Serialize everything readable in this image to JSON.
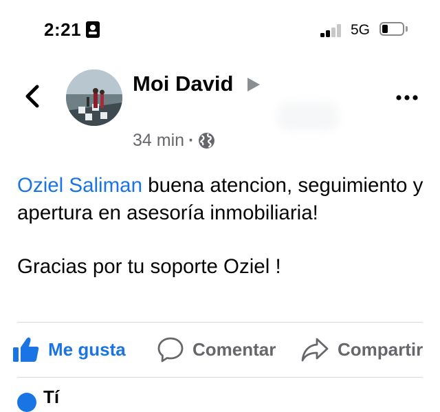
{
  "status_bar": {
    "time": "2:21",
    "network": "5G",
    "icons": [
      "contact-card-icon",
      "signal-icon",
      "battery-icon"
    ]
  },
  "post": {
    "author": "Moi David",
    "time": "34 min",
    "separator": "·",
    "audience_icon": "globe-icon",
    "mention": "Oziel Saliman",
    "text_after_mention": " buena atencion, seguimiento y apertura en asesoría inmobiliaria!",
    "paragraph2": "Gracias por tu soporte Oziel !"
  },
  "actions": {
    "like": "Me gusta",
    "comment": "Comentar",
    "share": "Compartir"
  },
  "next_item": {
    "text": "Tí"
  },
  "colors": {
    "accent": "#1b74e4",
    "secondary_text": "#65676b",
    "divider": "#d6d9dd"
  }
}
